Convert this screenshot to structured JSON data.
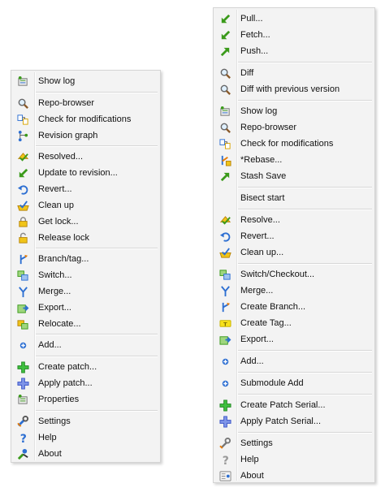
{
  "menus": {
    "left": {
      "items": [
        {
          "label": "Show log",
          "icon": "log-icon"
        },
        {
          "label": "Repo-browser",
          "icon": "magnifier-icon"
        },
        {
          "label": "Check for modifications",
          "icon": "check-modifications-icon"
        },
        {
          "label": "Revision graph",
          "icon": "revision-graph-icon"
        },
        {
          "label": "Resolved...",
          "icon": "resolved-icon"
        },
        {
          "label": "Update to revision...",
          "icon": "update-arrow-icon"
        },
        {
          "label": "Revert...",
          "icon": "revert-icon"
        },
        {
          "label": "Clean up",
          "icon": "cleanup-icon"
        },
        {
          "label": "Get lock...",
          "icon": "lock-icon"
        },
        {
          "label": "Release lock",
          "icon": "unlock-icon"
        },
        {
          "label": "Branch/tag...",
          "icon": "branch-icon"
        },
        {
          "label": "Switch...",
          "icon": "switch-icon"
        },
        {
          "label": "Merge...",
          "icon": "merge-icon"
        },
        {
          "label": "Export...",
          "icon": "export-icon"
        },
        {
          "label": "Relocate...",
          "icon": "relocate-icon"
        },
        {
          "label": "Add...",
          "icon": "add-icon"
        },
        {
          "label": "Create patch...",
          "icon": "create-patch-icon"
        },
        {
          "label": "Apply patch...",
          "icon": "apply-patch-icon"
        },
        {
          "label": "Properties",
          "icon": "properties-icon"
        },
        {
          "label": "Settings",
          "icon": "settings-icon"
        },
        {
          "label": "Help",
          "icon": "help-icon"
        },
        {
          "label": "About",
          "icon": "about-icon"
        }
      ]
    },
    "right": {
      "items": [
        {
          "label": "Pull...",
          "icon": "pull-arrow-icon"
        },
        {
          "label": "Fetch...",
          "icon": "fetch-arrow-icon"
        },
        {
          "label": "Push...",
          "icon": "push-arrow-icon"
        },
        {
          "label": "Diff",
          "icon": "magnifier-icon"
        },
        {
          "label": "Diff with previous version",
          "icon": "magnifier-icon"
        },
        {
          "label": "Show log",
          "icon": "log-icon"
        },
        {
          "label": "Repo-browser",
          "icon": "repo-browser-icon"
        },
        {
          "label": "Check for modifications",
          "icon": "check-modifications-icon"
        },
        {
          "label": "*Rebase...",
          "icon": "rebase-icon"
        },
        {
          "label": "Stash Save",
          "icon": "stash-arrow-icon"
        },
        {
          "label": "Bisect start",
          "icon": ""
        },
        {
          "label": "Resolve...",
          "icon": "resolved-icon"
        },
        {
          "label": "Revert...",
          "icon": "revert-icon"
        },
        {
          "label": "Clean up...",
          "icon": "cleanup-icon"
        },
        {
          "label": "Switch/Checkout...",
          "icon": "switch-icon"
        },
        {
          "label": "Merge...",
          "icon": "merge-icon"
        },
        {
          "label": "Create Branch...",
          "icon": "branch-icon"
        },
        {
          "label": "Create Tag...",
          "icon": "tag-icon"
        },
        {
          "label": "Export...",
          "icon": "export-icon"
        },
        {
          "label": "Add...",
          "icon": "add-icon"
        },
        {
          "label": "Submodule Add",
          "icon": "add-icon"
        },
        {
          "label": "Create Patch Serial...",
          "icon": "create-patch-icon"
        },
        {
          "label": "Apply Patch Serial...",
          "icon": "apply-patch-icon"
        },
        {
          "label": "Settings",
          "icon": "settings-icon"
        },
        {
          "label": "Help",
          "icon": "help-icon"
        },
        {
          "label": "About",
          "icon": "about-icon"
        }
      ]
    }
  },
  "colors": {
    "menu_background": "#f3f3f3",
    "menu_border": "#d4d4d4",
    "separator": "#d7d7d7",
    "arrow_green": "#3a9a1a",
    "blue": "#2d6fd2",
    "yellow": "#f0c419"
  }
}
